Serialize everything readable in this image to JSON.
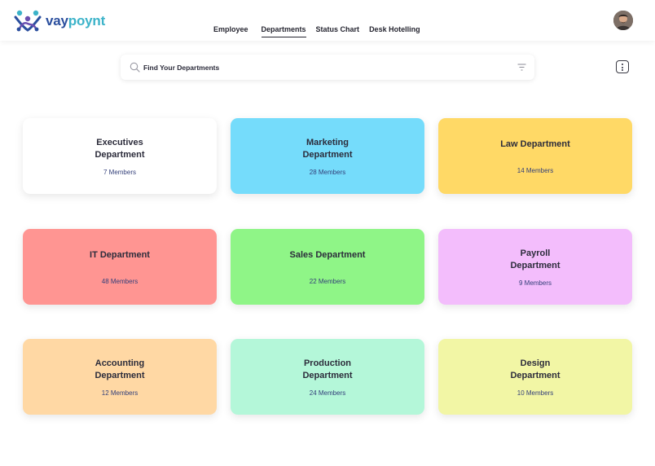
{
  "brand": {
    "name_part1": "vay",
    "name_part2": "poynt"
  },
  "nav": {
    "items": [
      {
        "label": "Employee",
        "active": false
      },
      {
        "label": "Departments",
        "active": true
      },
      {
        "label": "Status Chart",
        "active": false
      },
      {
        "label": "Desk Hotelling",
        "active": false
      }
    ]
  },
  "search": {
    "placeholder": "Find Your Departments"
  },
  "departments": [
    {
      "name": "Executives\nDepartment",
      "members": "7 Members",
      "color": "#ffffff"
    },
    {
      "name": "Marketing\nDepartment",
      "members": "28 Members",
      "color": "#75dcfb"
    },
    {
      "name": "Law Department",
      "members": "14 Members",
      "color": "#ffd966"
    },
    {
      "name": "IT Department",
      "members": "48 Members",
      "color": "#ff9592"
    },
    {
      "name": "Sales Department",
      "members": "22 Members",
      "color": "#8ff587"
    },
    {
      "name": "Payroll\nDepartment",
      "members": "9 Members",
      "color": "#f3bdfc"
    },
    {
      "name": "Accounting\nDepartment",
      "members": "12 Members",
      "color": "#ffd8a4"
    },
    {
      "name": "Production\nDepartment",
      "members": "24 Members",
      "color": "#b4f7d9"
    },
    {
      "name": "Design\nDepartment",
      "members": "10 Members",
      "color": "#f2f6a5"
    }
  ],
  "icons": {
    "logo": "vaypoynt-logo-icon",
    "search": "search-icon",
    "filter": "filter-icon",
    "more": "more-vertical-icon",
    "avatar": "user-avatar"
  }
}
